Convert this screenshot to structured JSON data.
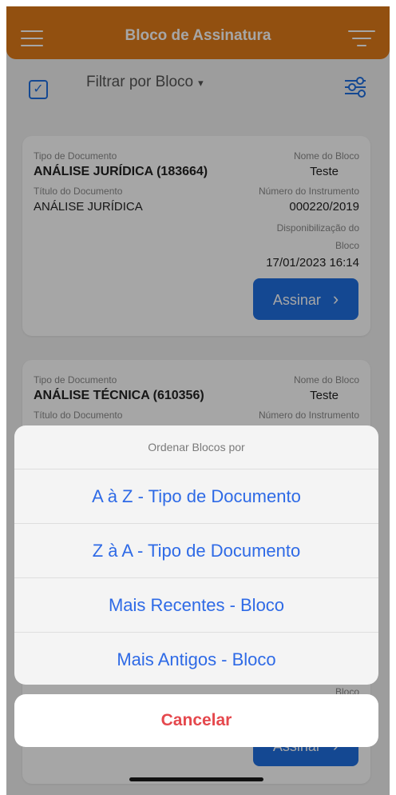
{
  "header": {
    "title": "Bloco de Assinatura",
    "menu_icon": "hamburger-icon",
    "sort_icon": "sort-lines-icon"
  },
  "toolbar": {
    "filter_label": "Filtrar por Bloco",
    "filter_caret": "▾",
    "checkbox_icon": "check-square-icon",
    "filter_icon": "sliders-icon"
  },
  "cards": [
    {
      "tipo_label": "Tipo de Documento",
      "tipo_value": "ANÁLISE JURÍDICA (183664)",
      "titulo_label": "Título do Documento",
      "titulo_value": "ANÁLISE JURÍDICA",
      "nome_label": "Nome do Bloco",
      "nome_value": "Teste",
      "numero_label": "Número do Instrumento",
      "numero_value": "000220/2019",
      "disp_label_1": "Disponibilização do",
      "disp_label_2": "Bloco",
      "disp_value": "17/01/2023 16:14",
      "button_label": "Assinar",
      "button_chevron": "›"
    },
    {
      "tipo_label": "Tipo de Documento",
      "tipo_value": "ANÁLISE TÉCNICA (610356)",
      "titulo_label": "Título do Documento",
      "nome_label": "Nome do Bloco",
      "nome_value": "Teste",
      "numero_label": "Número do Instrumento",
      "disp_label_2": "Bloco",
      "button_label": "Assinar",
      "button_chevron": "›"
    }
  ],
  "sheet": {
    "title": "Ordenar Blocos por",
    "options": [
      "A à Z - Tipo de Documento",
      "Z à A - Tipo de Documento",
      "Mais Recentes - Bloco",
      "Mais Antigos - Bloco"
    ],
    "cancel": "Cancelar"
  }
}
